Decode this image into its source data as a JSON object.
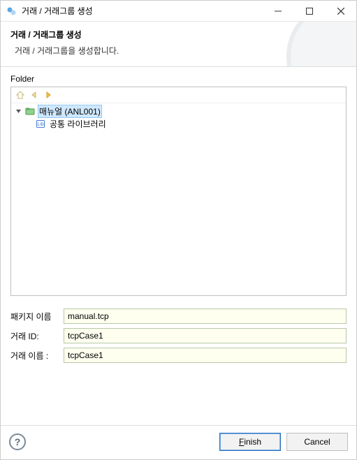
{
  "window": {
    "title": "거래 / 거래그룹 생성"
  },
  "banner": {
    "title": "거래 / 거래그룹 생성",
    "desc": "거래 / 거래그룹을 생성합니다."
  },
  "folder": {
    "label": "Folder",
    "tree": {
      "root": {
        "label": "매뉴얼 (ANL001)"
      },
      "child": {
        "label": "공통 라이브러리"
      }
    }
  },
  "form": {
    "packageLabel": "패키지 이름",
    "packageValue": "manual.tcp",
    "txIdLabel": "거래 ID:",
    "txIdValue": "tcpCase1",
    "txNameLabel": "거래 이름 :",
    "txNameValue": "tcpCase1"
  },
  "buttons": {
    "finishPrefix": "F",
    "finishRest": "inish",
    "cancel": "Cancel"
  }
}
